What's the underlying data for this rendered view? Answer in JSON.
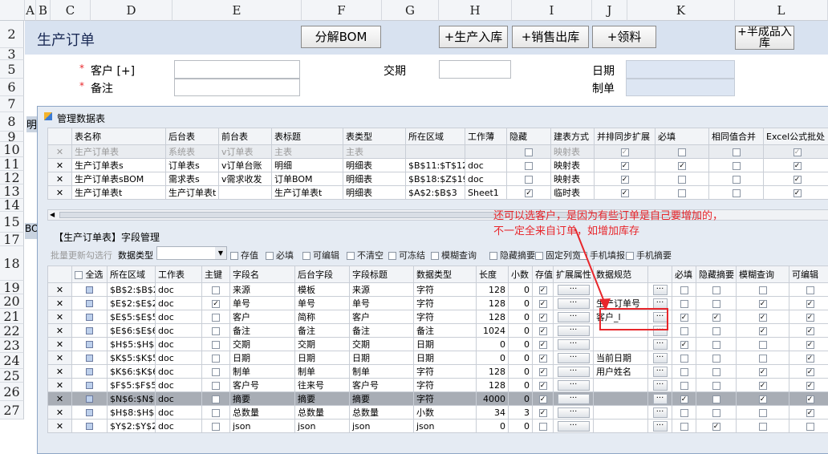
{
  "sheet": {
    "columns": [
      "A",
      "B",
      "C",
      "D",
      "E",
      "F",
      "G",
      "H",
      "I",
      "J",
      "K",
      "L"
    ],
    "rows": [
      "2",
      "3",
      "5",
      "6",
      "7",
      "8",
      "9",
      "10",
      "11",
      "12",
      "13",
      "14",
      "15",
      "17",
      "18",
      "19",
      "20",
      "21",
      "22",
      "23",
      "24",
      "25",
      "26",
      "27"
    ],
    "title": "生产订单",
    "buttons": {
      "decompose": "分解BOM",
      "prod_in": "+生产入库",
      "sales_out": "+销售出库",
      "pick": "+领料",
      "semi": "+半成品入库"
    },
    "labels": {
      "customer": "客户 [+]",
      "note": "备注",
      "due": "交期",
      "date": "日期",
      "maker": "制单"
    },
    "side": {
      "ming": "明",
      "bo": "BO"
    }
  },
  "dialog": {
    "title": "管理数据表",
    "top_headers": [
      "表名称",
      "后台表",
      "前台表",
      "表标题",
      "表类型",
      "所在区域",
      "工作薄",
      "隐藏",
      "建表方式",
      "并排同步扩展",
      "必填",
      "相同值合并",
      "Excel公式批处"
    ],
    "top_rows": [
      {
        "x": "✕",
        "name": "生产订单表",
        "backend": "系统表",
        "front": "v订单表",
        "title": "主表",
        "type": "主表",
        "area": "",
        "book": "",
        "hide": false,
        "method": "映射表",
        "sync": true,
        "req": false,
        "merge": false,
        "excel": true,
        "style": "gray"
      },
      {
        "x": "✕",
        "name": "生产订单表s",
        "backend": "订单表s",
        "front": "v订单台账",
        "title": "明细",
        "type": "明细表",
        "area": "$B$11:$T$12",
        "book": "doc",
        "hide": false,
        "method": "映射表",
        "sync": true,
        "req": true,
        "merge": false,
        "excel": true,
        "style": ""
      },
      {
        "x": "✕",
        "name": "生产订单表sBOM",
        "backend": "需求表s",
        "front": "v需求收发",
        "title": "订单BOM",
        "type": "明细表",
        "area": "$B$18:$Z$19",
        "book": "doc",
        "hide": false,
        "method": "映射表",
        "sync": true,
        "req": false,
        "merge": false,
        "excel": true,
        "style": ""
      },
      {
        "x": "✕",
        "name": "生产订单表t",
        "backend": "生产订单表t",
        "front": "",
        "title": "生产订单表t",
        "type": "明细表",
        "area": "$A$2:$B$3",
        "book": "Sheet1",
        "hide": true,
        "method": "临时表",
        "sync": true,
        "req": false,
        "merge": false,
        "excel": true,
        "style": ""
      }
    ],
    "section_title": "【生产订单表】字段管理",
    "toolbar": {
      "batch": "批量更新勾选行",
      "type_label": "数据类型",
      "type_value": "",
      "checks": [
        "存值",
        "必填",
        "可编辑",
        "不清空",
        "可冻结",
        "模糊查询",
        "隐藏摘要",
        "固定列宽",
        "手机填报",
        "手机摘要"
      ]
    },
    "annotation": "还可以选客户，是因为有些订单是自己要增加的，不一定全来自订单，如增加库存",
    "field_headers": [
      "全选",
      "所在区域",
      "工作表",
      "主键",
      "字段名",
      "后台字段",
      "字段标题",
      "数据类型",
      "长度",
      "小数",
      "存值",
      "扩展属性",
      "数据规范",
      "",
      "必填",
      "隐藏摘要",
      "模糊查询",
      "可编辑"
    ],
    "field_rows": [
      {
        "x": "✕",
        "area": "$B$2:$B$2",
        "sheet": "doc",
        "pk": false,
        "name": "来源",
        "back": "模板",
        "title": "来源",
        "dtype": "字符",
        "len": "128",
        "dec": "0",
        "store": true,
        "ext": "···",
        "spec": "",
        "more": "···",
        "req": false,
        "hidesum": false,
        "fuzzy": false,
        "edit": false,
        "style": ""
      },
      {
        "x": "✕",
        "area": "$E$2:$E$2",
        "sheet": "doc",
        "pk": true,
        "name": "单号",
        "back": "单号",
        "title": "单号",
        "dtype": "字符",
        "len": "128",
        "dec": "0",
        "store": true,
        "ext": "···",
        "spec": "生产订单号",
        "more": "···",
        "req": false,
        "hidesum": false,
        "fuzzy": true,
        "edit": true,
        "style": ""
      },
      {
        "x": "✕",
        "area": "$E$5:$E$5",
        "sheet": "doc",
        "pk": false,
        "name": "客户",
        "back": "简称",
        "title": "客户",
        "dtype": "字符",
        "len": "128",
        "dec": "0",
        "store": true,
        "ext": "···",
        "spec": "客户_l",
        "more": "···",
        "req": true,
        "hidesum": true,
        "fuzzy": true,
        "edit": true,
        "style": "",
        "boxed": true
      },
      {
        "x": "✕",
        "area": "$E$6:$E$6",
        "sheet": "doc",
        "pk": false,
        "name": "备注",
        "back": "备注",
        "title": "备注",
        "dtype": "备注",
        "len": "1024",
        "dec": "0",
        "store": true,
        "ext": "···",
        "spec": "",
        "more": "···",
        "req": false,
        "hidesum": false,
        "fuzzy": true,
        "edit": true,
        "style": ""
      },
      {
        "x": "✕",
        "area": "$H$5:$H$5",
        "sheet": "doc",
        "pk": false,
        "name": "交期",
        "back": "交期",
        "title": "交期",
        "dtype": "日期",
        "len": "0",
        "dec": "0",
        "store": true,
        "ext": "···",
        "spec": "",
        "more": "···",
        "req": true,
        "hidesum": false,
        "fuzzy": false,
        "edit": true,
        "style": ""
      },
      {
        "x": "✕",
        "area": "$K$5:$K$5",
        "sheet": "doc",
        "pk": false,
        "name": "日期",
        "back": "日期",
        "title": "日期",
        "dtype": "日期",
        "len": "0",
        "dec": "0",
        "store": true,
        "ext": "···",
        "spec": "当前日期",
        "more": "···",
        "req": false,
        "hidesum": false,
        "fuzzy": false,
        "edit": true,
        "style": ""
      },
      {
        "x": "✕",
        "area": "$K$6:$K$6",
        "sheet": "doc",
        "pk": false,
        "name": "制单",
        "back": "制单",
        "title": "制单",
        "dtype": "字符",
        "len": "128",
        "dec": "0",
        "store": true,
        "ext": "···",
        "spec": "用户姓名",
        "more": "···",
        "req": false,
        "hidesum": false,
        "fuzzy": true,
        "edit": true,
        "style": ""
      },
      {
        "x": "✕",
        "area": "$F$5:$F$5",
        "sheet": "doc",
        "pk": false,
        "name": "客户号",
        "back": "往来号",
        "title": "客户号",
        "dtype": "字符",
        "len": "128",
        "dec": "0",
        "store": true,
        "ext": "···",
        "spec": "",
        "more": "···",
        "req": false,
        "hidesum": false,
        "fuzzy": true,
        "edit": true,
        "style": ""
      },
      {
        "x": "✕",
        "area": "$N$6:$N$6",
        "sheet": "doc",
        "pk": false,
        "name": "摘要",
        "back": "摘要",
        "title": "摘要",
        "dtype": "字符",
        "len": "4000",
        "dec": "0",
        "store": true,
        "ext": "···",
        "spec": "",
        "more": "···",
        "req": true,
        "hidesum": false,
        "fuzzy": true,
        "edit": true,
        "style": "sel"
      },
      {
        "x": "✕",
        "area": "$H$8:$H$8",
        "sheet": "doc",
        "pk": false,
        "name": "总数量",
        "back": "总数量",
        "title": "总数量",
        "dtype": "小数",
        "len": "34",
        "dec": "3",
        "store": true,
        "ext": "···",
        "spec": "",
        "more": "···",
        "req": false,
        "hidesum": false,
        "fuzzy": false,
        "edit": true,
        "style": ""
      },
      {
        "x": "✕",
        "area": "$Y$2:$Y$2",
        "sheet": "doc",
        "pk": false,
        "name": "json",
        "back": "json",
        "title": "json",
        "dtype": "json",
        "len": "0",
        "dec": "0",
        "store": false,
        "ext": "···",
        "spec": "",
        "more": "···",
        "req": false,
        "hidesum": true,
        "fuzzy": false,
        "edit": false,
        "style": ""
      }
    ],
    "colors": {
      "accent": "#e8262b",
      "sheet_bg": "#dde6f3",
      "dialog_bg": "#e5ebf3"
    }
  }
}
